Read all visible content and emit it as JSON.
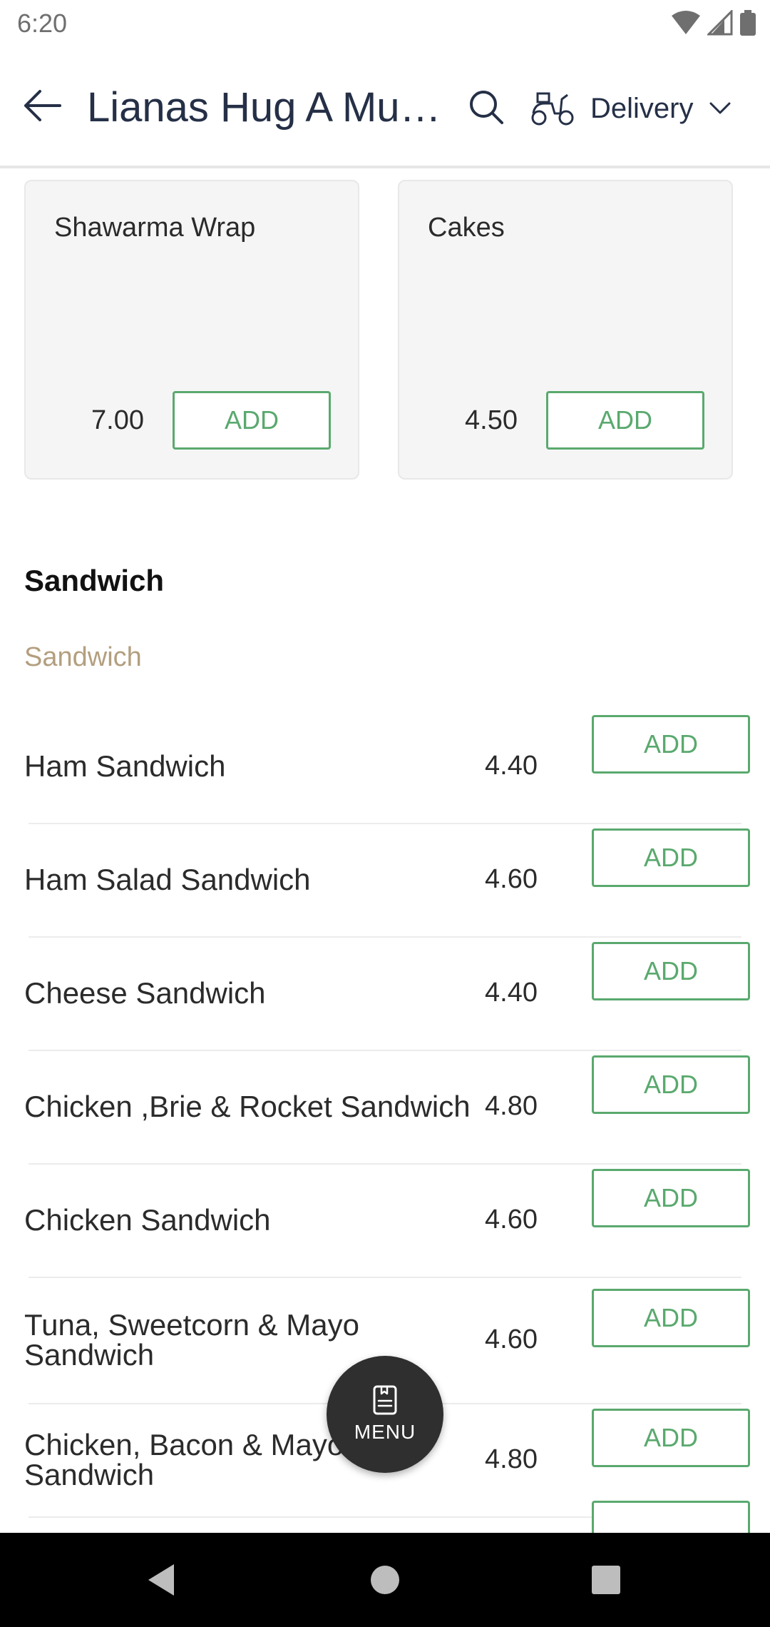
{
  "status_bar": {
    "time": "6:20"
  },
  "header": {
    "title": "Lianas Hug A Mug...",
    "order_mode": "Delivery"
  },
  "featured": [
    {
      "name": "Shawarma Wrap",
      "price": "7.00",
      "add_label": "ADD"
    },
    {
      "name": "Cakes",
      "price": "4.50",
      "add_label": "ADD"
    }
  ],
  "section": {
    "title": "Sandwich",
    "subtitle": "Sandwich"
  },
  "items": [
    {
      "name": "Ham Sandwich",
      "price": "4.40",
      "add_label": "ADD"
    },
    {
      "name": "Ham Salad Sandwich",
      "price": "4.60",
      "add_label": "ADD"
    },
    {
      "name": "Cheese Sandwich",
      "price": "4.40",
      "add_label": "ADD"
    },
    {
      "name": "Chicken ,Brie & Rocket Sandwich",
      "price": "4.80",
      "add_label": "ADD"
    },
    {
      "name": "Chicken Sandwich",
      "price": "4.60",
      "add_label": "ADD"
    },
    {
      "name": "Tuna, Sweetcorn & Mayo Sandwich",
      "price": "4.60",
      "add_label": "ADD"
    },
    {
      "name": "Chicken, Bacon & Mayo Sandwich",
      "price": "4.80",
      "add_label": "ADD"
    }
  ],
  "fab": {
    "label": "MENU"
  },
  "colors": {
    "accent_green": "#5aa96e",
    "subsection_tan": "#b39f7f",
    "title_navy": "#253047"
  },
  "icons": [
    "back-arrow-icon",
    "search-icon",
    "scooter-icon",
    "chevron-down-icon",
    "menu-book-icon",
    "nav-back-icon",
    "nav-home-icon",
    "nav-recents-icon",
    "wifi-icon",
    "signal-icon",
    "battery-icon"
  ]
}
